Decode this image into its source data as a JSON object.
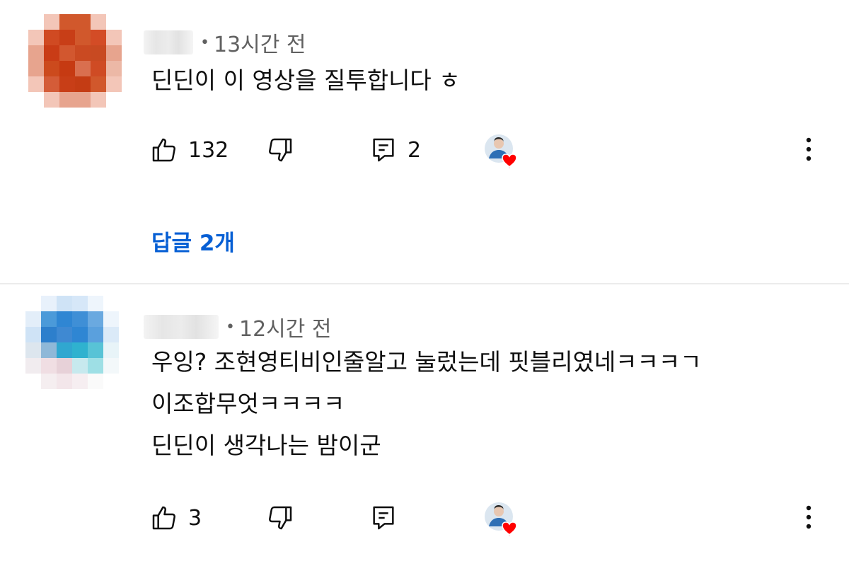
{
  "comments": [
    {
      "time": "13시간 전",
      "lines": [
        "딘딘이 이 영상을 질투합니다 ㅎ"
      ],
      "likes": "132",
      "replies_count": "2",
      "replies_link": "답글 2개",
      "avatar_palette": [
        [
          "#ffffff",
          "#f3c6b8",
          "#d1582c",
          "#d1582c",
          "#f3c6b8",
          "#ffffff"
        ],
        [
          "#f3c6b8",
          "#d04a22",
          "#c83e17",
          "#d1582c",
          "#d34c26",
          "#f3c6b8"
        ],
        [
          "#e7a48e",
          "#c93c16",
          "#d2572f",
          "#ca4a22",
          "#c84a22",
          "#e7a48e"
        ],
        [
          "#e7a48e",
          "#cc4a1d",
          "#c63a12",
          "#d96f4f",
          "#cf4b24",
          "#ecb8a6"
        ],
        [
          "#f3c6b8",
          "#d45c38",
          "#c83e17",
          "#c43c14",
          "#d1582c",
          "#f3c6b8"
        ],
        [
          "#ffffff",
          "#f3c6b8",
          "#e7a48e",
          "#e7a48e",
          "#f3c6b8",
          "#ffffff"
        ]
      ]
    },
    {
      "time": "12시간 전",
      "lines": [
        "우잉? 조현영티비인줄알고 눌렀는데 핏블리였네ㅋㅋㅋㄱ",
        "이조합무엇ㅋㅋㅋㅋ",
        "딘딘이 생각나는 밤이군"
      ],
      "likes": "3",
      "avatar_palette": [
        [
          "#ffffff",
          "#e8f1fb",
          "#cfe3f6",
          "#d6e7f8",
          "#eef5fc",
          "#ffffff"
        ],
        [
          "#e3eef9",
          "#4b9ad9",
          "#2f86d3",
          "#3f8fd6",
          "#6aa9e0",
          "#eef5fc"
        ],
        [
          "#cfe3f6",
          "#2d7fcc",
          "#3f89d2",
          "#2f86d3",
          "#5aa0dd",
          "#dbeaf8"
        ],
        [
          "#dde6ee",
          "#8fb8d8",
          "#30a7d0",
          "#2fb2cf",
          "#58c3d6",
          "#e8f4f8"
        ],
        [
          "#f1ecef",
          "#f0dee3",
          "#e7d1d8",
          "#c7e9ee",
          "#9edfe5",
          "#f3f8fa"
        ],
        [
          "#ffffff",
          "#f5eef0",
          "#f3e6ea",
          "#f6eef1",
          "#fafafa",
          "#ffffff"
        ]
      ]
    }
  ],
  "icons": {
    "like": "thumb-up-icon",
    "dislike": "thumb-down-icon",
    "reply": "comment-icon",
    "creator_heart": "creator-heart-icon",
    "more": "more-vert-icon"
  },
  "colors": {
    "link": "#065fd4",
    "heart": "#ff0000",
    "meta": "#606060"
  }
}
